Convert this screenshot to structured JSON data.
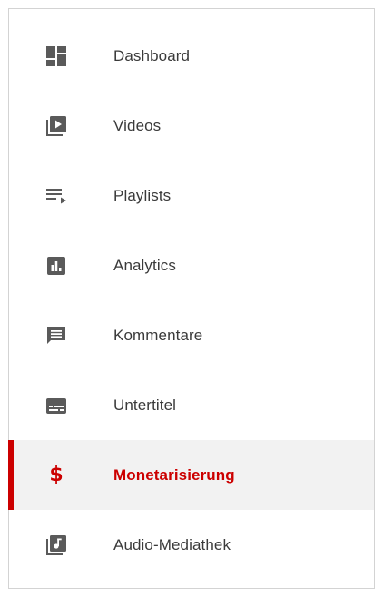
{
  "colors": {
    "icon": "#5a5a5a",
    "label": "#3a3a3a",
    "active": "#cc0000",
    "active_background": "#f2f2f2",
    "border": "#d3d3d3"
  },
  "sidebar": {
    "items": [
      {
        "label": "Dashboard",
        "icon": "dashboard-icon",
        "active": false
      },
      {
        "label": "Videos",
        "icon": "video-library-icon",
        "active": false
      },
      {
        "label": "Playlists",
        "icon": "playlist-icon",
        "active": false
      },
      {
        "label": "Analytics",
        "icon": "analytics-icon",
        "active": false
      },
      {
        "label": "Kommentare",
        "icon": "comment-icon",
        "active": false
      },
      {
        "label": "Untertitel",
        "icon": "subtitles-icon",
        "active": false
      },
      {
        "label": "Monetarisierung",
        "icon": "dollar-icon",
        "icon_glyph": "$",
        "active": true
      },
      {
        "label": "Audio-Mediathek",
        "icon": "audio-library-icon",
        "active": false
      }
    ]
  }
}
